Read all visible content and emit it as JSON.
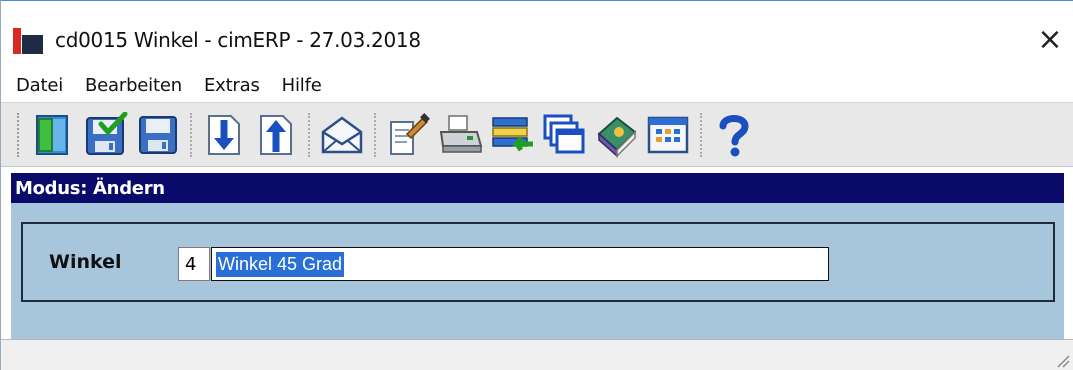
{
  "window": {
    "title": "cd0015 Winkel - cimERP - 27.03.2018",
    "close_glyph": "×"
  },
  "menu": {
    "items": [
      {
        "label": "Datei"
      },
      {
        "label": "Bearbeiten"
      },
      {
        "label": "Extras"
      },
      {
        "label": "Hilfe"
      }
    ]
  },
  "toolbar": {
    "buttons": [
      {
        "icon": "exit-door-icon"
      },
      {
        "icon": "save-check-icon"
      },
      {
        "icon": "save-icon"
      },
      {
        "icon": "download-document-icon"
      },
      {
        "icon": "upload-document-icon"
      },
      {
        "icon": "mail-icon"
      },
      {
        "icon": "edit-document-icon"
      },
      {
        "icon": "printer-icon"
      },
      {
        "icon": "list-transfer-icon"
      },
      {
        "icon": "windows-icon"
      },
      {
        "icon": "book-icon"
      },
      {
        "icon": "calendar-grid-icon"
      },
      {
        "icon": "help-icon"
      }
    ]
  },
  "mode": {
    "text": "Modus: Ändern"
  },
  "form": {
    "label": "Winkel",
    "code_value": "4",
    "name_value": "Winkel 45 Grad"
  },
  "colors": {
    "mode_bar": "#0a0a6b",
    "content_bg": "#a7c6dc",
    "selection": "#2a6fd6",
    "brand_red": "#d62b20"
  }
}
